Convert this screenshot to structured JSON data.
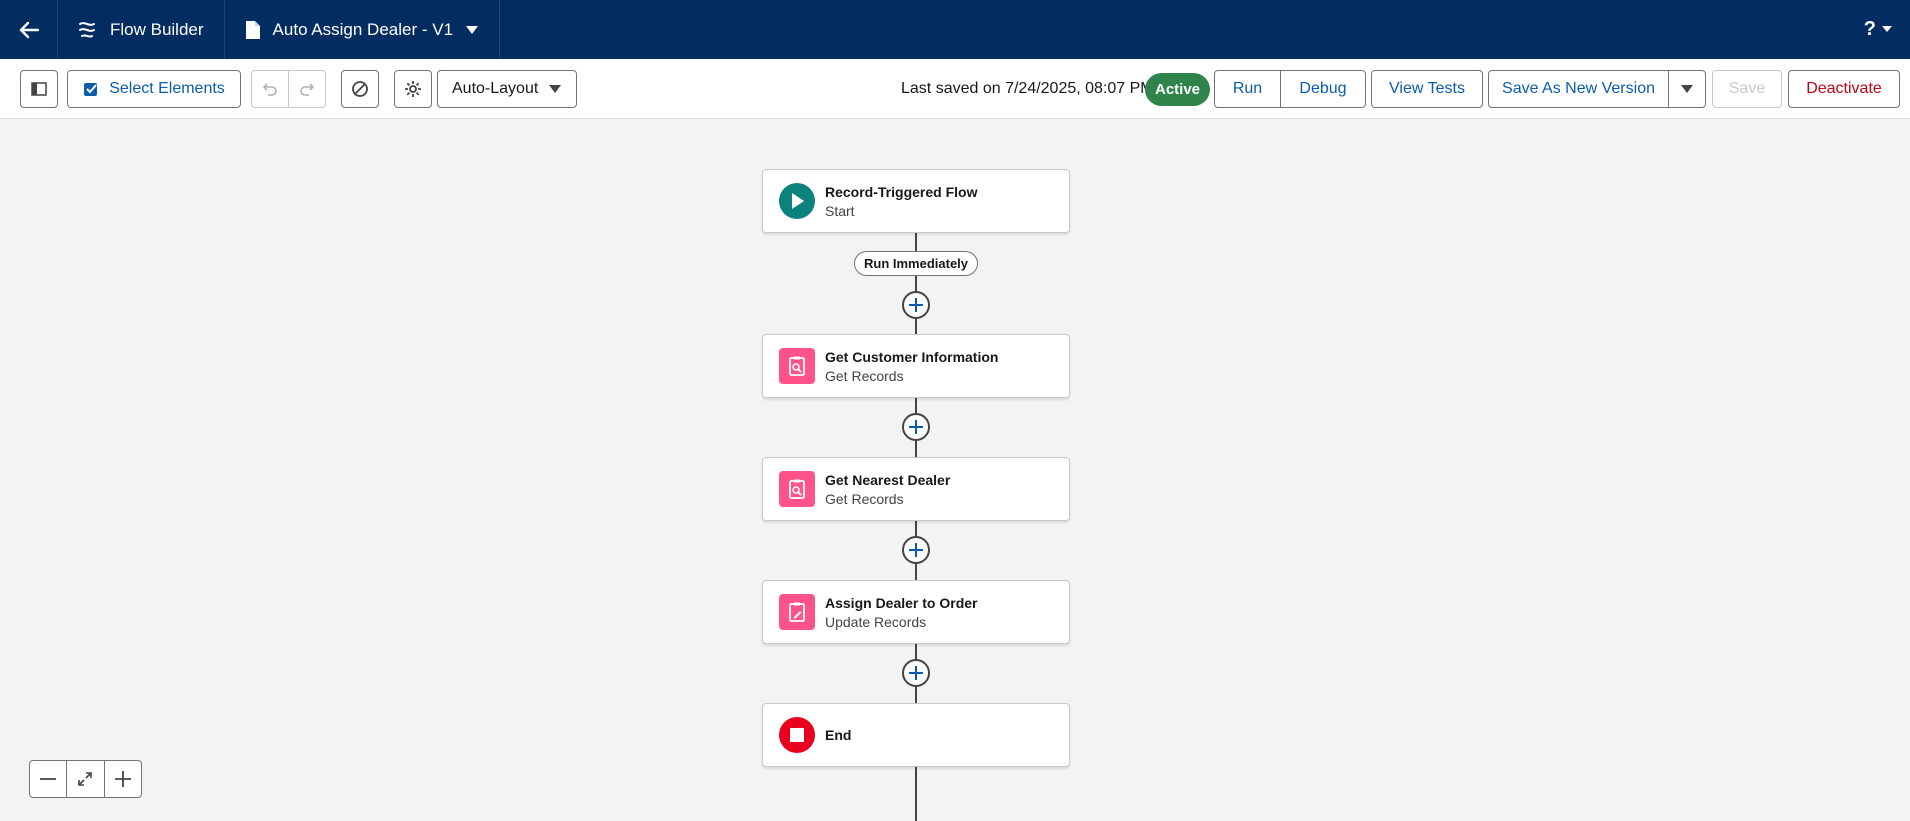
{
  "header": {
    "app_name": "Flow Builder",
    "document_title": "Auto Assign Dealer - V1",
    "help_label": "?"
  },
  "toolbar": {
    "select_elements_label": "Select Elements",
    "layout_select_value": "Auto-Layout",
    "last_saved": "Last saved on 7/24/2025, 08:07 PM",
    "status_badge": "Active",
    "run_label": "Run",
    "debug_label": "Debug",
    "view_tests_label": "View Tests",
    "save_as_new_version_label": "Save As New Version",
    "save_label": "Save",
    "deactivate_label": "Deactivate"
  },
  "flow": {
    "start": {
      "title": "Record-Triggered Flow",
      "subtitle": "Start",
      "icon": "play-icon"
    },
    "run_path_label": "Run Immediately",
    "elements": [
      {
        "title": "Get Customer Information",
        "subtitle": "Get Records",
        "icon": "get-records-icon"
      },
      {
        "title": "Get Nearest Dealer",
        "subtitle": "Get Records",
        "icon": "get-records-icon"
      },
      {
        "title": "Assign Dealer to Order",
        "subtitle": "Update Records",
        "icon": "update-records-icon"
      }
    ],
    "end": {
      "title": "End",
      "icon": "stop-icon"
    }
  },
  "colors": {
    "header_bg": "#032d60",
    "brand_blue": "#0b5cab",
    "active_green": "#2e844a",
    "start_teal": "#0b827c",
    "records_pink": "#ff538a",
    "end_red": "#ea001e",
    "deactivate_red": "#ba0517"
  }
}
